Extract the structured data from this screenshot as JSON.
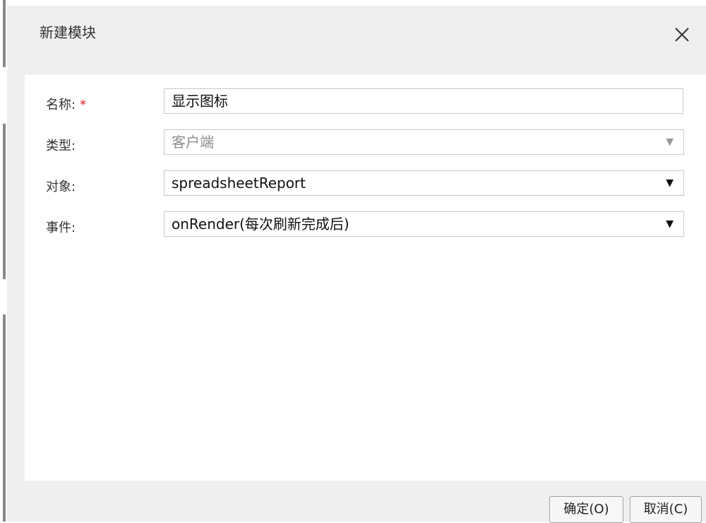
{
  "dialog": {
    "title": "新建模块",
    "close_icon": "close-icon",
    "ok_label": "确定(O)",
    "cancel_label": "取消(C)"
  },
  "form": {
    "name": {
      "label": "名称:",
      "required_mark": "*",
      "value": "显示图标"
    },
    "type": {
      "label": "类型:",
      "value": "客户端",
      "disabled": true
    },
    "object": {
      "label": "对象:",
      "value": "spreadsheetReport"
    },
    "event": {
      "label": "事件:",
      "value": "onRender(每次刷新完成后)"
    }
  },
  "colors": {
    "dialog_bg": "#efefef",
    "panel_bg": "#ffffff",
    "required": "#e02020",
    "disabled_text": "#8c8c8c"
  }
}
